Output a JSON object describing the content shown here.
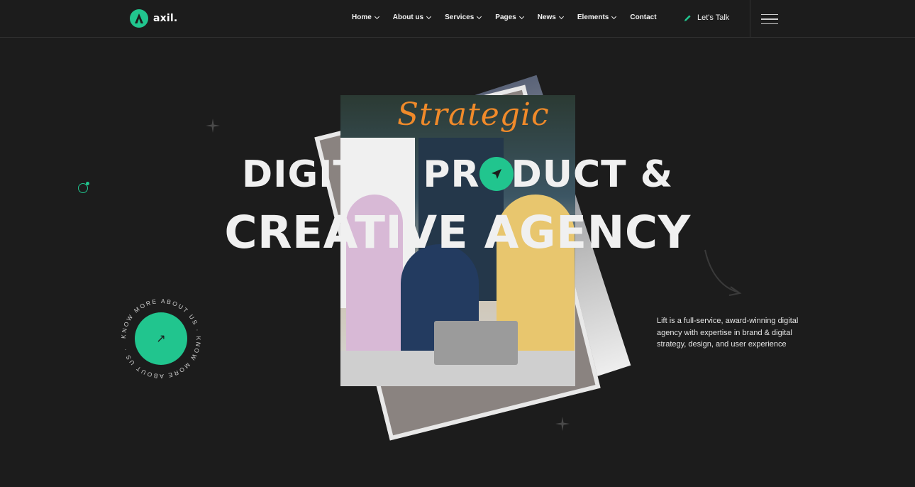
{
  "brand": {
    "name": "axil.",
    "accent": "#21c58e"
  },
  "nav": {
    "items": [
      {
        "label": "Home",
        "has_dropdown": true
      },
      {
        "label": "About us",
        "has_dropdown": true
      },
      {
        "label": "Services",
        "has_dropdown": true
      },
      {
        "label": "Pages",
        "has_dropdown": true
      },
      {
        "label": "News",
        "has_dropdown": true
      },
      {
        "label": "Elements",
        "has_dropdown": true
      },
      {
        "label": "Contact",
        "has_dropdown": false
      }
    ],
    "cta_label": "Let's Talk",
    "cta_icon": "pencil-icon",
    "menu_icon": "hamburger-icon"
  },
  "hero": {
    "script_word": "Strategic",
    "line1_a": "DIGITAL PR",
    "line1_b": "DUCT &",
    "line2": "CREATIVE AGENCY",
    "badge_icon": "send-icon",
    "description": "Lift is a full-service, award-winning digital agency with expertise in brand & digital strategy, design, and user experience"
  },
  "circle_cta": {
    "ring_text": "KNOW MORE ABOUT US · KNOW MORE ABOUT US · ",
    "icon": "arrow-up-right-icon",
    "symbol": "↗"
  },
  "colors": {
    "background": "#1c1c1c",
    "script": "#f08a2a",
    "lime": "#b9f22a"
  }
}
